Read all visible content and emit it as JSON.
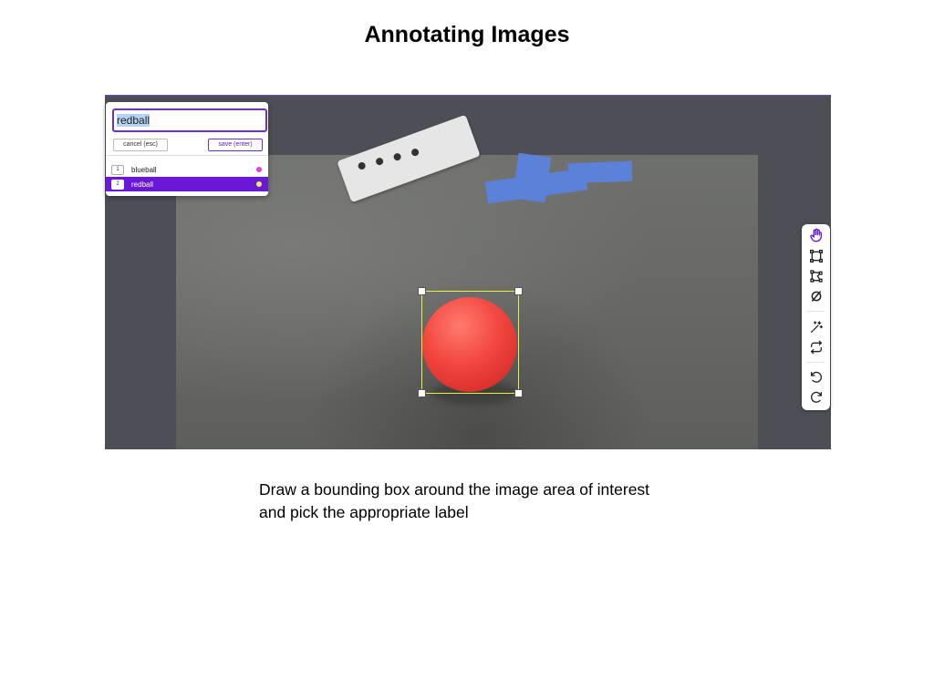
{
  "page": {
    "title": "Annotating Images",
    "caption_line1": "Draw a bounding box around the image area of interest",
    "caption_line2": "and pick the appropriate label"
  },
  "label_popup": {
    "input_value": "redball",
    "cancel_label": "cancel (esc)",
    "save_label": "save (enter)",
    "labels": [
      {
        "shortcut": "1",
        "name": "blueball",
        "color": "#e83ce8",
        "selected": false
      },
      {
        "shortcut": "2",
        "name": "redball",
        "color": "#e6f05a",
        "selected": true
      }
    ]
  },
  "annotation": {
    "box_color": "#e9f23a",
    "label": "redball"
  },
  "toolbar": {
    "tools": [
      {
        "icon": "hand-icon",
        "active": true
      },
      {
        "icon": "rectangle-icon",
        "active": false
      },
      {
        "icon": "polygon-icon",
        "active": false
      },
      {
        "icon": "no-object-icon",
        "active": false
      },
      {
        "icon": "magic-wand-icon",
        "active": false
      },
      {
        "icon": "repeat-icon",
        "active": false
      },
      {
        "icon": "undo-icon",
        "active": false
      },
      {
        "icon": "redo-icon",
        "active": false
      }
    ]
  },
  "colors": {
    "accent": "#6a17d6",
    "canvas_background": "#4d4e56"
  }
}
